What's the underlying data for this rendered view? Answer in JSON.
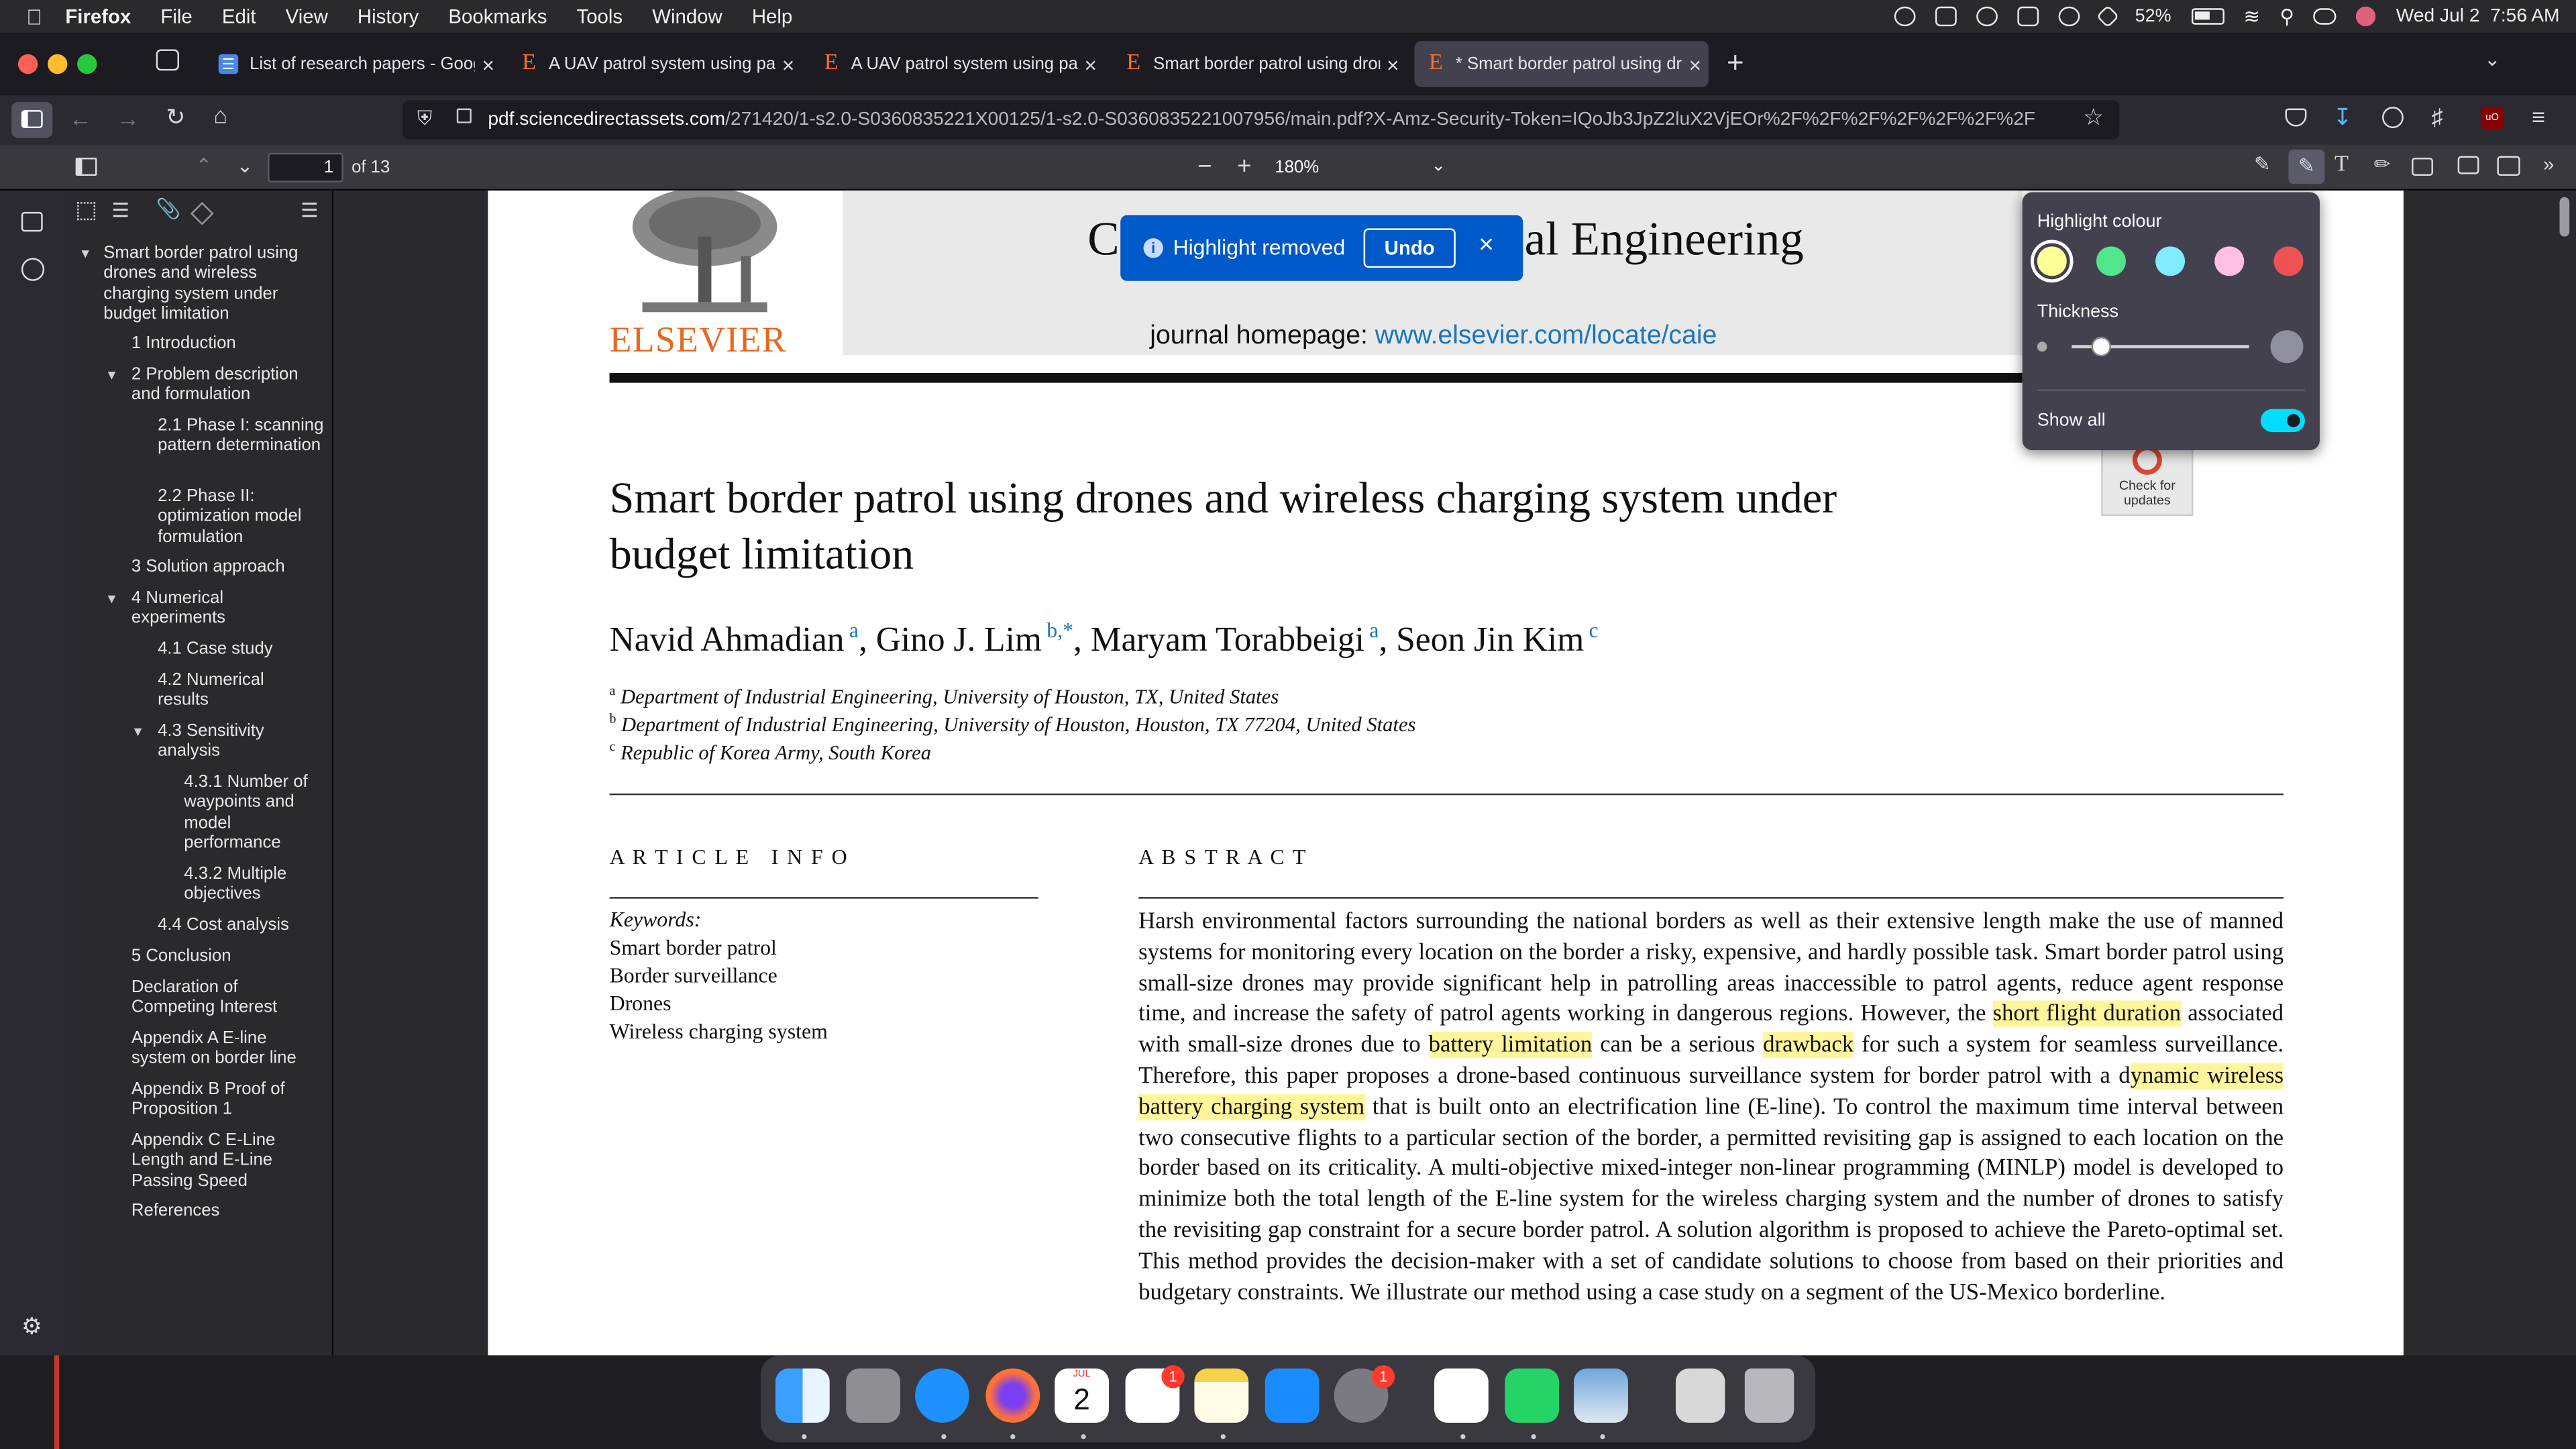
{
  "menubar": {
    "app": "Firefox",
    "items": [
      "File",
      "Edit",
      "View",
      "History",
      "Bookmarks",
      "Tools",
      "Window",
      "Help"
    ],
    "battery": "52%",
    "datetime": "Wed Jul 2  7:56 AM"
  },
  "tabs": [
    {
      "label": "List of research papers - Google",
      "icon": "google-docs-icon"
    },
    {
      "label": "A UAV patrol system using pano",
      "icon": "elsevier-icon"
    },
    {
      "label": "A UAV patrol system using pano",
      "icon": "elsevier-icon"
    },
    {
      "label": "Smart border patrol using drone",
      "icon": "elsevier-icon"
    },
    {
      "label": "* Smart border patrol using dron",
      "icon": "elsevier-icon"
    }
  ],
  "url": {
    "host": "pdf.sciencedirectassets.com",
    "path": "/271420/1-s2.0-S0360835221X00125/1-s2.0-S0360835221007956/main.pdf?X-Amz-Security-Token=IQoJb3JpZ2luX2VjEOr%2F%2F%2F%2F%2F%2F%2F"
  },
  "pdf_toolbar": {
    "page": "1",
    "of_pages": "of 13",
    "zoom": "180%"
  },
  "outline": [
    "Smart border patrol using drones and wireless charging system under budget limitation",
    "1 Introduction",
    "2 Problem description and formulation",
    "2.1 Phase I: scanning pattern determination",
    "2.2 Phase II: optimization model formulation",
    "3 Solution approach",
    "4 Numerical experiments",
    "4.1 Case study",
    "4.2 Numerical results",
    "4.3 Sensitivity analysis",
    "4.3.1 Number of waypoints and model performance",
    "4.3.2 Multiple objectives",
    "4.4 Cost analysis",
    "5 Conclusion",
    "Declaration of Competing Interest",
    "Appendix A E-line system on border line",
    "Appendix B Proof of Proposition 1",
    "Appendix C E-Line Length and E-Line Passing Speed",
    "References"
  ],
  "doc": {
    "publisher": "ELSEVIER",
    "journal_left": "C",
    "journal_right": "al Engineering",
    "homepage_label": "journal homepage:",
    "homepage_link": "www.elsevier.com/locate/caie",
    "title_line1": "Smart border patrol using drones and wireless charging system under",
    "title_line2": "budget limitation",
    "authors": [
      {
        "name": "Navid Ahmadian",
        "sup": "a"
      },
      {
        "name": "Gino J. Lim",
        "sup": "b,*"
      },
      {
        "name": "Maryam Torabbeigi",
        "sup": "a"
      },
      {
        "name": "Seon Jin Kim",
        "sup": "c"
      }
    ],
    "affiliations": [
      {
        "sup": "a",
        "text": "Department of Industrial Engineering, University of Houston, TX, United States"
      },
      {
        "sup": "b",
        "text": "Department of Industrial Engineering, University of Houston, Houston, TX 77204, United States"
      },
      {
        "sup": "c",
        "text": "Republic of Korea Army, South Korea"
      }
    ],
    "article_info_heading": "A R T I C L E   I N F O",
    "keywords_label": "Keywords:",
    "keywords": [
      "Smart border patrol",
      "Border surveillance",
      "Drones",
      "Wireless charging system"
    ],
    "abstract_heading": "A B S T R A C T",
    "abstract": {
      "p1": "Harsh environmental factors surrounding the national borders as well as their extensive length make the use of manned systems for monitoring every location on the border a risky, expensive, and hardly possible task. Smart border patrol using small-size drones may provide significant help in patrolling areas inaccessible to patrol agents, reduce agent response time, and increase the safety of patrol agents working in dangerous regions. However, the ",
      "h1": "short flight duration",
      "p2": " associated with small-size drones due to ",
      "h2": "battery limitation",
      "p3": " can be a serious ",
      "h3": "drawback",
      "p4": " for such a system for seamless surveillance. Therefore, this paper proposes a drone-based continuous surveillance system for border patrol with a d",
      "h4": "ynamic wireless battery charging system",
      "p5": " that is built onto an electrification line (E-line). To control the maximum time interval between two consecutive flights to a particular section of the border, a permitted revisiting gap is assigned to each location on the border based on its criticality. A multi-objective mixed-integer non-linear programming (MINLP) model is developed to minimize both the total length of the E-line system for the wireless charging system and the number of drones to satisfy the revisiting gap constraint for a secure border patrol. A solution algorithm is proposed to achieve the Pareto-optimal set. This method provides the decision-maker with a set of candidate solutions to choose from based on their priorities and budgetary constraints. We illustrate our method using a case study on a segment of the US-Mexico borderline."
    },
    "check_updates": "Check for updates"
  },
  "toast": {
    "message": "Highlight removed",
    "undo": "Undo"
  },
  "highlight_panel": {
    "title": "Highlight colour",
    "thickness": "Thickness",
    "show_all": "Show all",
    "thickness_value": 0.17,
    "colors": [
      "#ffff98",
      "#53e58d",
      "#80ebff",
      "#ffc0e3",
      "#ef5252"
    ],
    "show_all_on": true
  },
  "dock": {
    "calendar_month": "JUL",
    "calendar_day": "2",
    "badges": [
      "1",
      "1"
    ]
  }
}
